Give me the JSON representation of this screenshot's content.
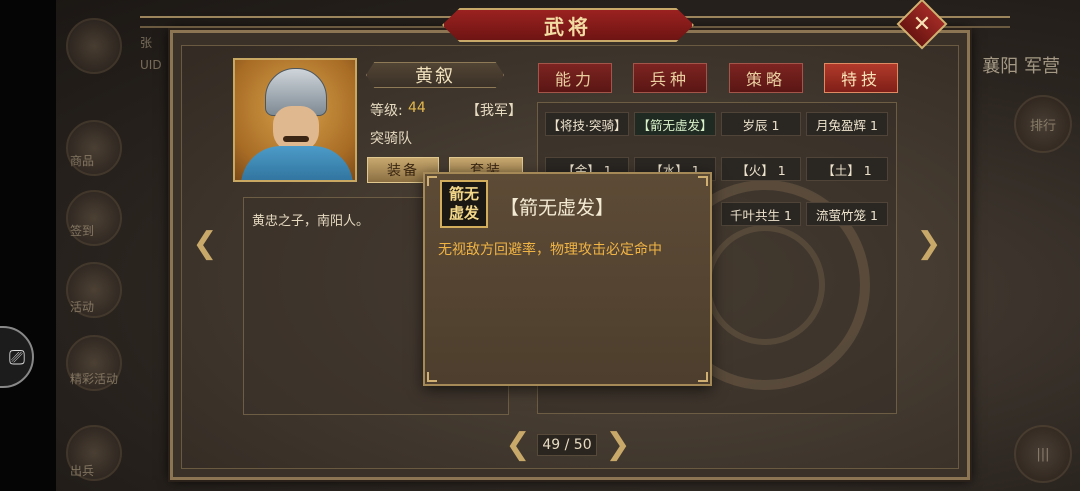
{
  "window": {
    "title": "武将"
  },
  "background": {
    "top_right": "襄阳  军营",
    "left_labels": [
      "商品",
      "签到",
      "活动",
      "精彩活动",
      "出兵"
    ],
    "right_labels": [
      "排行"
    ],
    "partial_left_text": [
      "张",
      "UID"
    ],
    "record_icon": "record-icon"
  },
  "general": {
    "name": "黄叙",
    "level_label": "等级:",
    "level_value": "44",
    "faction": "【我军】",
    "unit": "突骑队",
    "equip_button": "装备",
    "outfit_button": "套装",
    "bio": "黄忠之子，南阳人。"
  },
  "tabs": [
    {
      "label": "能力",
      "active": false
    },
    {
      "label": "兵种",
      "active": false
    },
    {
      "label": "策略",
      "active": false
    },
    {
      "label": "特技",
      "active": true
    }
  ],
  "skills": {
    "row1": [
      "【将技·突骑】",
      "【箭无虚发】",
      "岁辰 1",
      "月兔盈辉 1"
    ],
    "row2": [
      "【金】 1",
      "【水】 1",
      "【火】 1",
      "【土】 1"
    ],
    "row3": [
      "千叶共生 1",
      "流萤竹笼 1"
    ]
  },
  "tooltip": {
    "icon_text": "箭无\n虚发",
    "icon_line1": "箭无",
    "icon_line2": "虚发",
    "title": "【箭无虚发】",
    "description": "无视敌方回避率，物理攻击必定命中"
  },
  "pager": {
    "text": "49 / 50"
  },
  "colors": {
    "accent_red": "#9b2220",
    "gold": "#c9a96a",
    "highlight_orange": "#f0b445",
    "level_yellow": "#e3b84c"
  }
}
